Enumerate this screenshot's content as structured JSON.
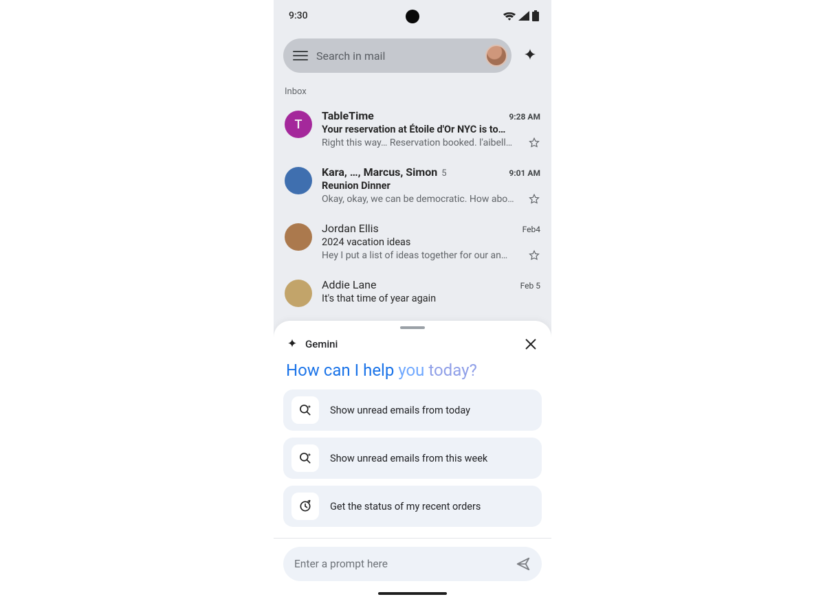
{
  "status": {
    "time": "9:30"
  },
  "search": {
    "placeholder": "Search in mail"
  },
  "section_label": "Inbox",
  "emails": [
    {
      "sender": "TableTime",
      "time": "9:28 AM",
      "subject": "Your reservation at Étoile d'Or NYC is to…",
      "snippet": "Right this way… Reservation booked. l'aibell…",
      "unread": true,
      "avatar_letter": "T",
      "avatar_color": "#a9229f",
      "thread_count": ""
    },
    {
      "sender": "Kara, …, Marcus, Simon",
      "time": "9:01 AM",
      "subject": "Reunion Dinner",
      "snippet": "Okay, okay, we can be democratic. How abo…",
      "unread": true,
      "avatar_letter": "",
      "avatar_color": "#3b6fb5",
      "thread_count": "5"
    },
    {
      "sender": "Jordan Ellis",
      "time": "Feb4",
      "subject": "2024 vacation ideas",
      "snippet": "Hey I put a list of ideas together for our an…",
      "unread": false,
      "avatar_letter": "",
      "avatar_color": "#b07a4a",
      "thread_count": ""
    },
    {
      "sender": "Addie Lane",
      "time": "Feb 5",
      "subject": "It's that time of year again",
      "snippet": "",
      "unread": false,
      "avatar_letter": "",
      "avatar_color": "#c9a96a",
      "thread_count": ""
    }
  ],
  "gemini": {
    "title": "Gemini",
    "greeting": {
      "part1": "How can I help ",
      "part2": "you ",
      "part3": "today?"
    },
    "suggestions": [
      {
        "icon": "search-sparkle",
        "label": "Show unread emails from today"
      },
      {
        "icon": "search-sparkle",
        "label": "Show unread emails from this week"
      },
      {
        "icon": "refresh-clock",
        "label": "Get the status of my recent orders"
      }
    ],
    "prompt_placeholder": "Enter a prompt here"
  }
}
